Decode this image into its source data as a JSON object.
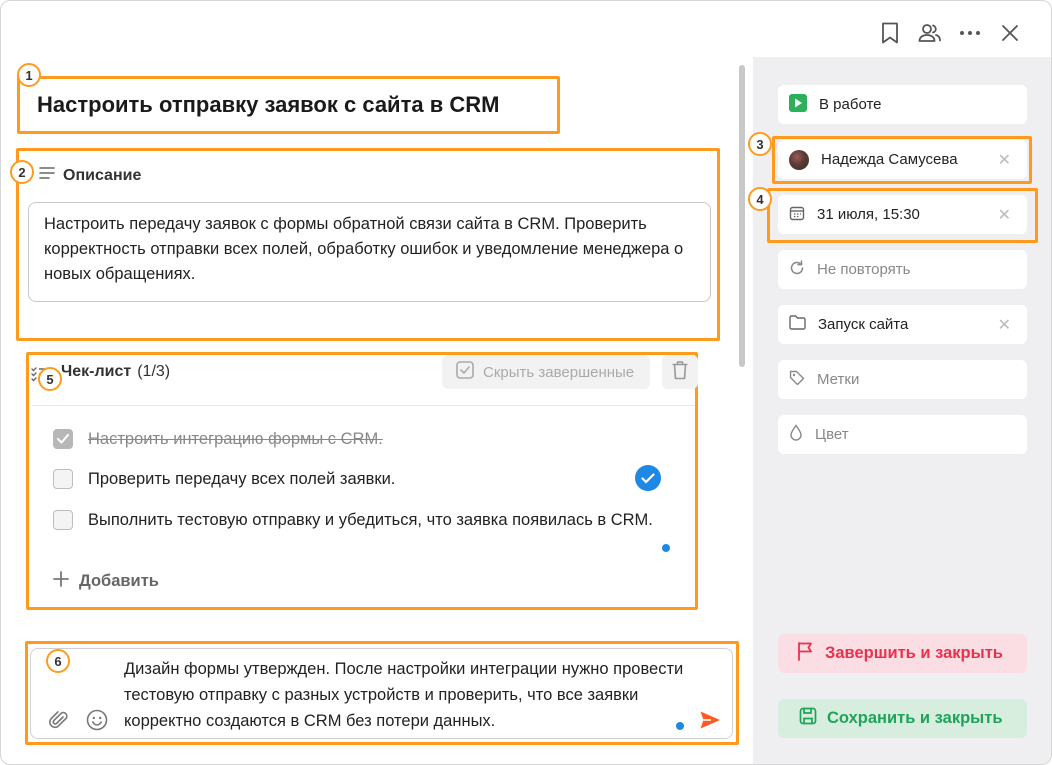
{
  "task": {
    "title": "Настроить отправку заявок с сайта в CRM",
    "description_label": "Описание",
    "description": "Настроить передачу заявок с формы обратной связи сайта в CRM. Проверить корректность отправки всех полей, обработку ошибок и уведомление менеджера о новых обращениях."
  },
  "annotations": [
    "1",
    "2",
    "3",
    "4",
    "5",
    "6"
  ],
  "checklist": {
    "title": "Чек-лист",
    "count": "(1/3)",
    "hide_done_label": "Скрыть завершенные",
    "add_label": "Добавить",
    "items": [
      {
        "text": "Настроить интеграцию формы с CRM.",
        "done": true
      },
      {
        "text": "Проверить передачу всех полей заявки.",
        "done": false
      },
      {
        "text": "Выполнить тестовую отправку и убедиться, что заявка появилась в CRM.",
        "done": false
      }
    ]
  },
  "comment": {
    "text": "Дизайн формы утвержден. После настройки интеграции нужно провести тестовую отправку с разных устройств и проверить, что все заявки корректно создаются в CRM без потери данных."
  },
  "sidebar": {
    "status": "В работе",
    "assignee": "Надежда Самусева",
    "deadline": "31 июля, 15:30",
    "repeat": "Не повторять",
    "project": "Запуск сайта",
    "tags": "Метки",
    "color": "Цвет"
  },
  "actions": {
    "finish_label": "Завершить и закрыть",
    "save_label": "Сохранить и закрыть"
  },
  "colors": {
    "accent_highlight": "#ff9a1f",
    "status_green": "#2cb05a",
    "finish_red": "#e8324e",
    "save_green": "#1fa35a",
    "check_blue": "#1e88e5"
  }
}
